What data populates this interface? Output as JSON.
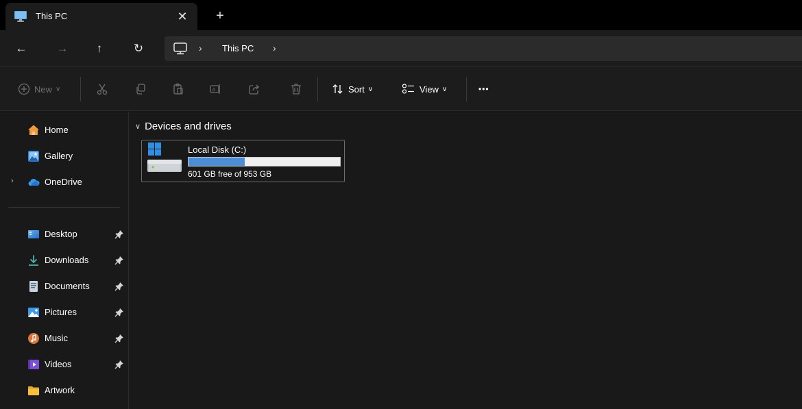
{
  "tabs": [
    {
      "title": "This PC",
      "close_glyph": "✕"
    }
  ],
  "new_tab_glyph": "+",
  "nav": {
    "back_glyph": "←",
    "forward_glyph": "→",
    "up_glyph": "↑",
    "refresh_glyph": "↻"
  },
  "address": {
    "separator": "›",
    "segments": [
      "This PC"
    ]
  },
  "commandbar": {
    "new_label": "New",
    "sort_label": "Sort",
    "view_label": "View",
    "more_label": "•••",
    "dropdown_glyph": "∨"
  },
  "sidebar": {
    "expander_glyph": "›",
    "top_items": [
      {
        "label": "Home",
        "icon": "home-icon"
      },
      {
        "label": "Gallery",
        "icon": "gallery-icon"
      },
      {
        "label": "OneDrive",
        "icon": "onedrive-icon",
        "expandable": true
      }
    ],
    "pinned_items": [
      {
        "label": "Desktop",
        "icon": "desktop-icon",
        "pinned": true
      },
      {
        "label": "Downloads",
        "icon": "downloads-icon",
        "pinned": true
      },
      {
        "label": "Documents",
        "icon": "documents-icon",
        "pinned": true
      },
      {
        "label": "Pictures",
        "icon": "pictures-icon",
        "pinned": true
      },
      {
        "label": "Music",
        "icon": "music-icon",
        "pinned": true
      },
      {
        "label": "Videos",
        "icon": "videos-icon",
        "pinned": true
      },
      {
        "label": "Artwork",
        "icon": "folder-icon",
        "pinned": false
      }
    ]
  },
  "content": {
    "group_title": "Devices and drives",
    "group_chevron": "∨",
    "drives": [
      {
        "name": "Local Disk (C:)",
        "free_text": "601 GB free of 953 GB",
        "used_fraction": 0.37
      }
    ]
  },
  "colors": {
    "accent": "#4c8ed6",
    "background": "#191919",
    "titlebar": "#000000",
    "folder": "#f8c03a"
  }
}
